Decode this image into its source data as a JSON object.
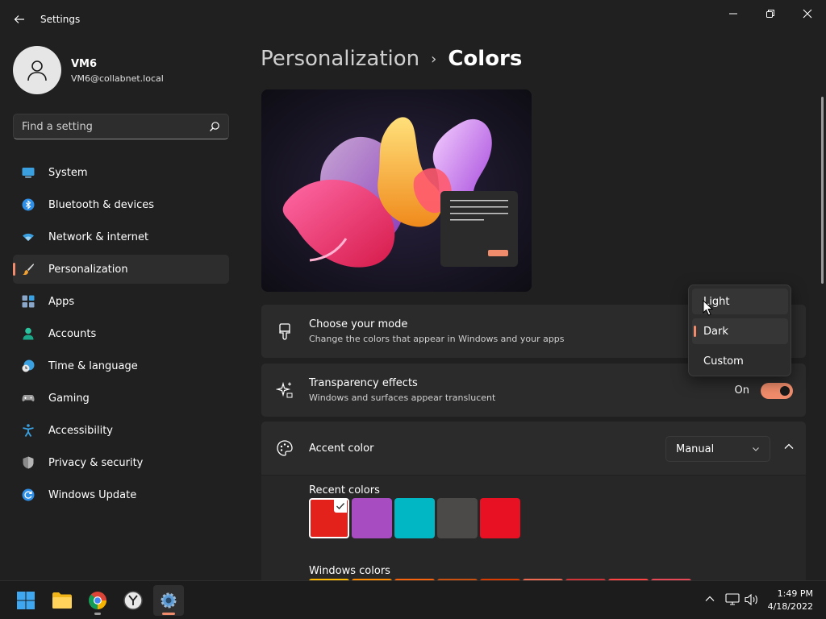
{
  "window": {
    "title": "Settings",
    "back_icon": "arrow-left-icon",
    "minimize_icon": "minimize-icon",
    "maximize_icon": "restore-icon",
    "close_icon": "close-icon"
  },
  "user": {
    "name": "VM6",
    "email": "VM6@collabnet.local",
    "avatar_icon": "person-icon"
  },
  "search": {
    "placeholder": "Find a setting",
    "icon": "search-icon"
  },
  "sidebar": {
    "items": [
      {
        "label": "System",
        "icon": "monitor-icon"
      },
      {
        "label": "Bluetooth & devices",
        "icon": "bluetooth-icon"
      },
      {
        "label": "Network & internet",
        "icon": "wifi-icon"
      },
      {
        "label": "Personalization",
        "icon": "brush-icon",
        "active": true
      },
      {
        "label": "Apps",
        "icon": "apps-icon"
      },
      {
        "label": "Accounts",
        "icon": "person-icon"
      },
      {
        "label": "Time & language",
        "icon": "clock-globe-icon"
      },
      {
        "label": "Gaming",
        "icon": "gamepad-icon"
      },
      {
        "label": "Accessibility",
        "icon": "accessibility-icon"
      },
      {
        "label": "Privacy & security",
        "icon": "shield-icon"
      },
      {
        "label": "Windows Update",
        "icon": "update-icon"
      }
    ]
  },
  "breadcrumb": {
    "parent": "Personalization",
    "separator": "›",
    "current": "Colors"
  },
  "mode": {
    "title": "Choose your mode",
    "description": "Change the colors that appear in Windows and your apps",
    "icon": "paintbrush-icon"
  },
  "transparency": {
    "title": "Transparency effects",
    "description": "Windows and surfaces appear translucent",
    "state_label": "On",
    "icon": "sparkle-icon"
  },
  "accent": {
    "title": "Accent color",
    "icon": "palette-icon",
    "select_value": "Manual",
    "recent_label": "Recent colors",
    "recent_colors": [
      "#e3221b",
      "#a74cc1",
      "#00b7c3",
      "#4c4a48",
      "#e81123"
    ],
    "selected_recent_index": 0,
    "windows_label": "Windows colors",
    "windows_colors": [
      "#ffb900",
      "#ff8c00",
      "#f7630c",
      "#ca5010",
      "#da3b01",
      "#ef6950",
      "#d13438",
      "#ff4343",
      "#e74856"
    ]
  },
  "mode_dropdown": {
    "options": [
      "Light",
      "Dark",
      "Custom"
    ],
    "selected": "Dark",
    "hovered": "Light"
  },
  "colors": {
    "accent": "#f08c6b",
    "background": "#202020",
    "card": "#2b2b2b"
  },
  "taskbar": {
    "apps": [
      "start-icon",
      "file-explorer-icon",
      "chrome-icon",
      "clock-app-icon",
      "settings-icon"
    ],
    "tray": [
      "chevron-up-icon",
      "network-icon",
      "volume-icon"
    ],
    "time": "1:49 PM",
    "date": "4/18/2022"
  }
}
